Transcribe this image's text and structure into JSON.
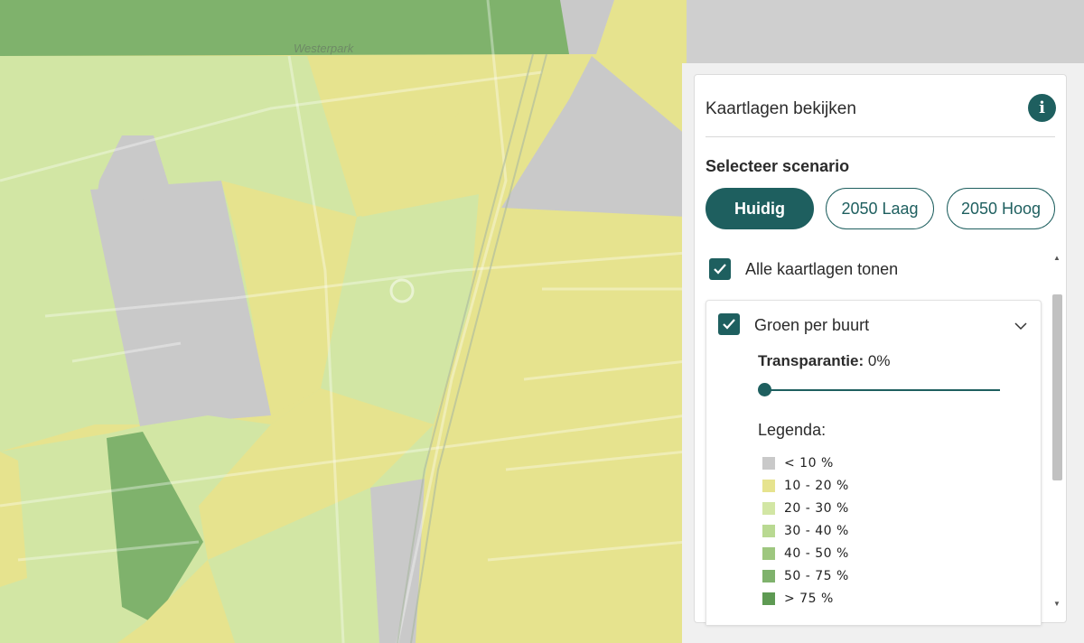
{
  "map": {
    "park_label": "Westerpark",
    "colors": {
      "lt10": "#c9c9c9",
      "10_20": "#e6e38e",
      "20_30": "#d2e6a4",
      "30_40": "#b9d992",
      "40_50": "#9ec77f",
      "50_75": "#7fb26c",
      "gt75": "#5e9a53"
    }
  },
  "panel": {
    "title": "Kaartlagen bekijken",
    "info_icon": "info-icon",
    "scenario_title": "Selecteer scenario",
    "scenarios": [
      {
        "label": "Huidig",
        "active": true
      },
      {
        "label": "2050 Laag",
        "active": false
      },
      {
        "label": "2050 Hoog",
        "active": false
      }
    ],
    "show_all_label": "Alle kaartlagen tonen",
    "layer": {
      "name": "Groen per buurt",
      "transparency_label": "Transparantie:",
      "transparency_value": "0%",
      "transparency_percent": 0,
      "legend_title": "Legenda:",
      "legend": [
        {
          "label": "< 10 %",
          "color": "#c9c9c9"
        },
        {
          "label": "10 - 20 %",
          "color": "#e6e38e"
        },
        {
          "label": "20 - 30 %",
          "color": "#d2e6a4"
        },
        {
          "label": "30 - 40 %",
          "color": "#b9d992"
        },
        {
          "label": "40 - 50 %",
          "color": "#9ec77f"
        },
        {
          "label": "50 - 75 %",
          "color": "#7fb26c"
        },
        {
          "label": "> 75 %",
          "color": "#5e9a53"
        }
      ]
    }
  }
}
